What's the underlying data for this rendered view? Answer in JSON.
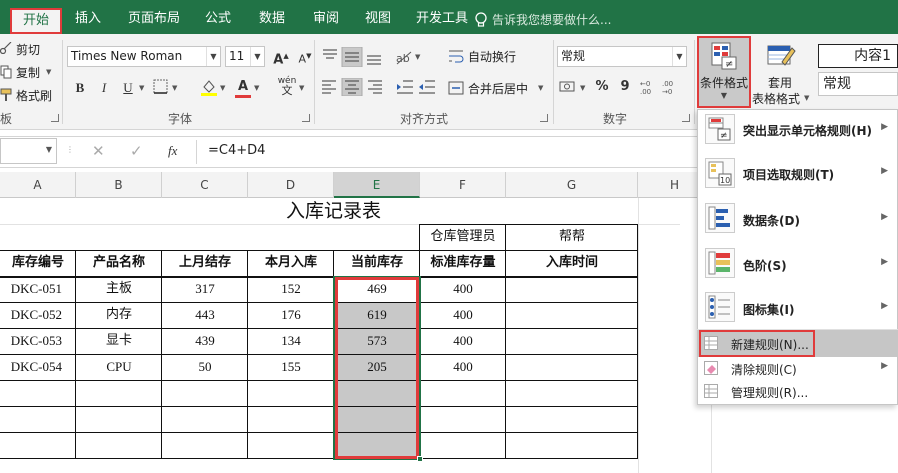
{
  "tabs": [
    {
      "label": "开始",
      "active": true
    },
    {
      "label": "插入"
    },
    {
      "label": "页面布局"
    },
    {
      "label": "公式"
    },
    {
      "label": "数据"
    },
    {
      "label": "审阅"
    },
    {
      "label": "视图"
    },
    {
      "label": "开发工具"
    }
  ],
  "tell_me": "告诉我您想要做什么...",
  "clipboard": {
    "cut": "剪切",
    "copy": "复制",
    "format_painter": "格式刷",
    "group": "板"
  },
  "font": {
    "name": "Times New Roman",
    "size": "11",
    "group": "字体",
    "wen": "wén",
    "wen_char": "文"
  },
  "alignment": {
    "wrap": "自动换行",
    "merge": "合并后居中",
    "group": "对齐方式"
  },
  "number": {
    "format": "常规",
    "percent": "%",
    "comma": "9",
    "group": "数字"
  },
  "styles": {
    "conditional_format": "条件格式",
    "table_format_1": "套用",
    "table_format_2": "表格格式",
    "style_box_1": "内容1",
    "style_box_2": "常规"
  },
  "formula_bar": {
    "fx": "fx",
    "formula": "=C4+D4"
  },
  "columns": [
    "A",
    "B",
    "C",
    "D",
    "E",
    "F",
    "G",
    "H"
  ],
  "sheet": {
    "title": "入库记录表",
    "f2": "仓库管理员",
    "g2": "帮帮",
    "headers": [
      "库存编号",
      "产品名称",
      "上月结存",
      "本月入库",
      "当前库存",
      "标准库存量",
      "入库时间"
    ],
    "rows": [
      [
        "DKC-051",
        "主板",
        "317",
        "152",
        "469",
        "400",
        ""
      ],
      [
        "DKC-052",
        "内存",
        "443",
        "176",
        "619",
        "400",
        ""
      ],
      [
        "DKC-053",
        "显卡",
        "439",
        "134",
        "573",
        "400",
        ""
      ],
      [
        "DKC-054",
        "CPU",
        "50",
        "155",
        "205",
        "400",
        ""
      ]
    ]
  },
  "menu": {
    "items": [
      {
        "label": "突出显示单元格规则(H)"
      },
      {
        "label": "项目选取规则(T)"
      },
      {
        "label": "数据条(D)"
      },
      {
        "label": "色阶(S)"
      },
      {
        "label": "图标集(I)"
      }
    ],
    "new_rule": "新建规则(N)...",
    "clear_rule": "清除规则(C)",
    "manage_rule": "管理规则(R)...",
    "icon_text_1": "≠",
    "icon_text_2": "10"
  },
  "colors": {
    "excel_green": "#217346",
    "highlight_red": "#e03b3b",
    "selection_gray": "#c8c8c8"
  }
}
